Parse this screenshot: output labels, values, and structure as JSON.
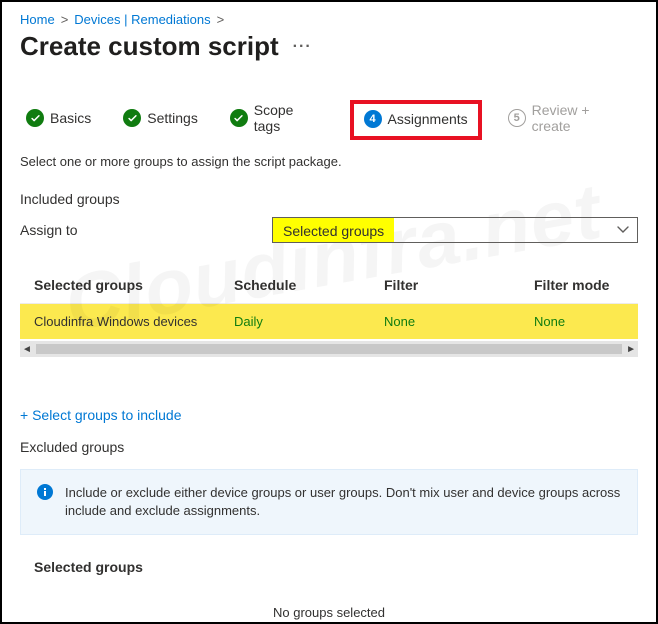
{
  "breadcrumb": {
    "home": "Home",
    "devices": "Devices | Remediations"
  },
  "page_title": "Create custom script",
  "steps": {
    "s1": {
      "label": "Basics"
    },
    "s2": {
      "label": "Settings"
    },
    "s3": {
      "label": "Scope tags"
    },
    "s4": {
      "num": "4",
      "label": "Assignments"
    },
    "s5": {
      "num": "5",
      "label": "Review + create"
    }
  },
  "instruction": "Select one or more groups to assign the script package.",
  "included": {
    "heading": "Included groups",
    "assign_to_label": "Assign to",
    "assign_to_value": "Selected groups",
    "columns": {
      "c1": "Selected groups",
      "c2": "Schedule",
      "c3": "Filter",
      "c4": "Filter mode"
    },
    "rows": [
      {
        "group": "Cloudinfra Windows devices",
        "schedule": "Daily",
        "filter": "None",
        "filter_mode": "None"
      }
    ],
    "add_link": "+ Select groups to include"
  },
  "excluded": {
    "heading": "Excluded groups",
    "info": "Include or exclude either device groups or user groups. Don't mix user and device groups across include and exclude assignments.",
    "selected_heading": "Selected groups",
    "empty": "No groups selected"
  },
  "watermark": "Cloudinfra.net"
}
